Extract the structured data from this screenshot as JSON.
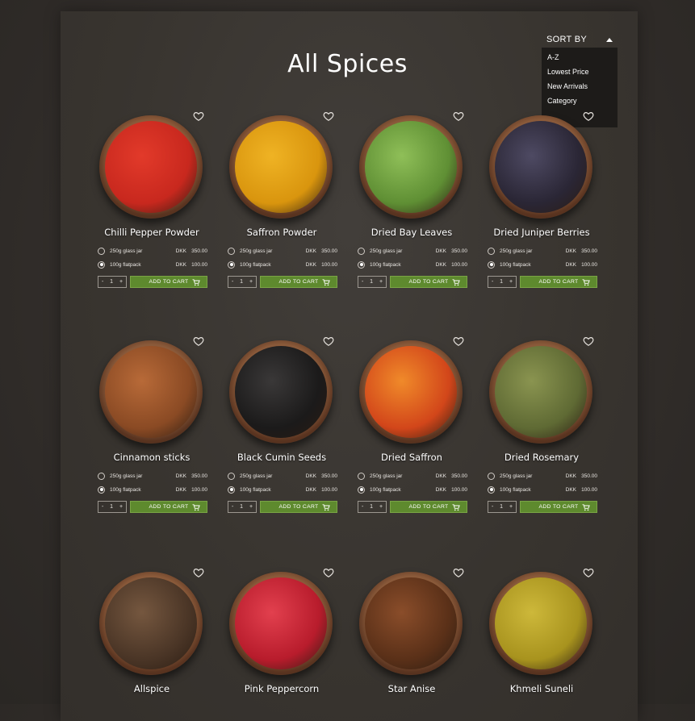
{
  "page": {
    "title": "All Spices"
  },
  "sort": {
    "label": "SORT BY",
    "options": [
      "A-Z",
      "Lowest Price",
      "New Arrivals",
      "Category"
    ]
  },
  "currency": "DKK",
  "products": [
    {
      "name": "Chilli Pepper Powder",
      "bowl_color": "#c8281e",
      "bowl_accent": "#e23a2a",
      "options": [
        {
          "label": "250g glass jar",
          "price": "350.00",
          "selected": false
        },
        {
          "label": "100g flatpack",
          "price": "100.00",
          "selected": true
        }
      ],
      "qty": "1",
      "cart_label": "ADD TO CART"
    },
    {
      "name": "Saffron Powder",
      "bowl_color": "#d9950e",
      "bowl_accent": "#efb324",
      "options": [
        {
          "label": "250g glass jar",
          "price": "350.00",
          "selected": false
        },
        {
          "label": "100g flatpack",
          "price": "100.00",
          "selected": true
        }
      ],
      "qty": "1",
      "cart_label": "ADD TO CART"
    },
    {
      "name": "Dried Bay Leaves",
      "bowl_color": "#5f8f34",
      "bowl_accent": "#8fbf58",
      "options": [
        {
          "label": "250g glass jar",
          "price": "350.00",
          "selected": false
        },
        {
          "label": "100g flatpack",
          "price": "100.00",
          "selected": true
        }
      ],
      "qty": "1",
      "cart_label": "ADD TO CART"
    },
    {
      "name": "Dried Juniper Berries",
      "bowl_color": "#2a2635",
      "bowl_accent": "#4e4a63",
      "options": [
        {
          "label": "250g glass jar",
          "price": "350.00",
          "selected": false
        },
        {
          "label": "100g flatpack",
          "price": "100.00",
          "selected": true
        }
      ],
      "qty": "1",
      "cart_label": "ADD TO CART"
    },
    {
      "name": "Cinnamon sticks",
      "bowl_color": "#8a4a24",
      "bowl_accent": "#b86a38",
      "options": [
        {
          "label": "250g glass jar",
          "price": "350.00",
          "selected": false
        },
        {
          "label": "100g flatpack",
          "price": "100.00",
          "selected": true
        }
      ],
      "qty": "1",
      "cart_label": "ADD TO CART"
    },
    {
      "name": "Black Cumin Seeds",
      "bowl_color": "#1b1a1a",
      "bowl_accent": "#3a3838",
      "options": [
        {
          "label": "250g glass jar",
          "price": "350.00",
          "selected": false
        },
        {
          "label": "100g flatpack",
          "price": "100.00",
          "selected": true
        }
      ],
      "qty": "1",
      "cart_label": "ADD TO CART"
    },
    {
      "name": "Dried Saffron",
      "bowl_color": "#d2461a",
      "bowl_accent": "#f08a2a",
      "options": [
        {
          "label": "250g glass jar",
          "price": "350.00",
          "selected": false
        },
        {
          "label": "100g flatpack",
          "price": "100.00",
          "selected": true
        }
      ],
      "qty": "1",
      "cart_label": "ADD TO CART"
    },
    {
      "name": "Dried Rosemary",
      "bowl_color": "#5f6a34",
      "bowl_accent": "#8a9450",
      "options": [
        {
          "label": "250g glass jar",
          "price": "350.00",
          "selected": false
        },
        {
          "label": "100g flatpack",
          "price": "100.00",
          "selected": true
        }
      ],
      "qty": "1",
      "cart_label": "ADD TO CART"
    },
    {
      "name": "Allspice",
      "bowl_color": "#4a3526",
      "bowl_accent": "#75573f",
      "options": [],
      "qty": "",
      "cart_label": ""
    },
    {
      "name": "Pink Peppercorn",
      "bowl_color": "#b81c2c",
      "bowl_accent": "#e2404e",
      "options": [],
      "qty": "",
      "cart_label": ""
    },
    {
      "name": "Star Anise",
      "bowl_color": "#5a3018",
      "bowl_accent": "#8a4d2a",
      "options": [],
      "qty": "",
      "cart_label": ""
    },
    {
      "name": "Khmeli Suneli",
      "bowl_color": "#a8931e",
      "bowl_accent": "#cdb83a",
      "options": [],
      "qty": "",
      "cart_label": ""
    }
  ]
}
